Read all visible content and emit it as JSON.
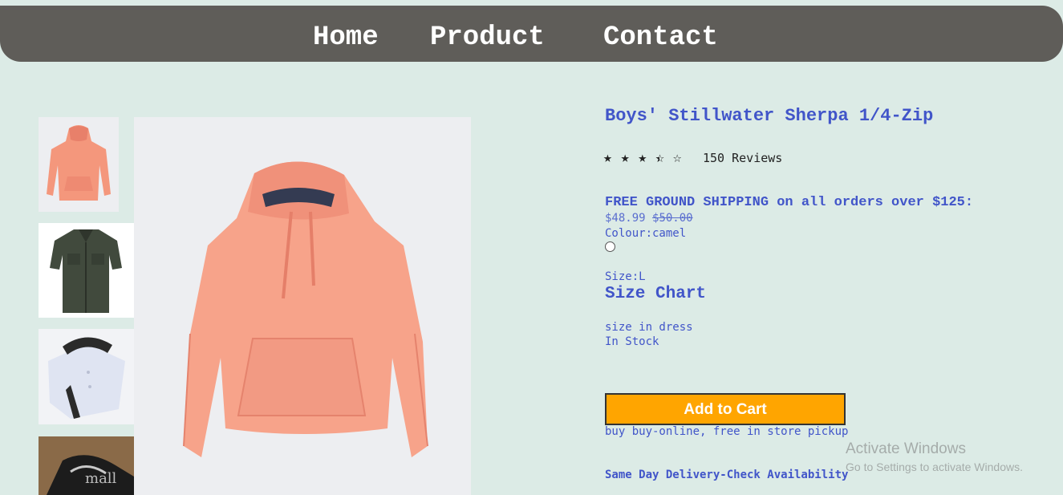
{
  "nav": {
    "home": "Home",
    "product": "Product",
    "contact": "Contact"
  },
  "gallery": {
    "thumbnails": [
      "pink-hoodie",
      "green-shirt",
      "white-shirt",
      "black-shoes"
    ],
    "main_image": "pink-hoodie",
    "thumb_watermark": "mall"
  },
  "product": {
    "title": "Boys' Stillwater Sherpa 1/4-Zip",
    "rating": 3.5,
    "rating_max": 5,
    "reviews": "150 Reviews",
    "shipping": "FREE GROUND SHIPPING on all orders over $125:",
    "price": "$48.99",
    "old_price": "$50.00",
    "colour": "Colour:camel",
    "size": "Size:L",
    "size_chart": "Size Chart",
    "size_note": "size in dress",
    "stock": "In Stock",
    "add_to_cart": "Add to Cart",
    "pickup": "buy buy-online, free in store pickup",
    "delivery": "Same Day Delivery-Check Availability"
  },
  "watermark": {
    "line1": "Activate Windows",
    "line2": "Go to Settings to activate Windows."
  },
  "colors": {
    "background": "#dcebe6",
    "nav": "#5f5d59",
    "accent_text": "#4155c9",
    "cart_button": "#ffa500"
  }
}
